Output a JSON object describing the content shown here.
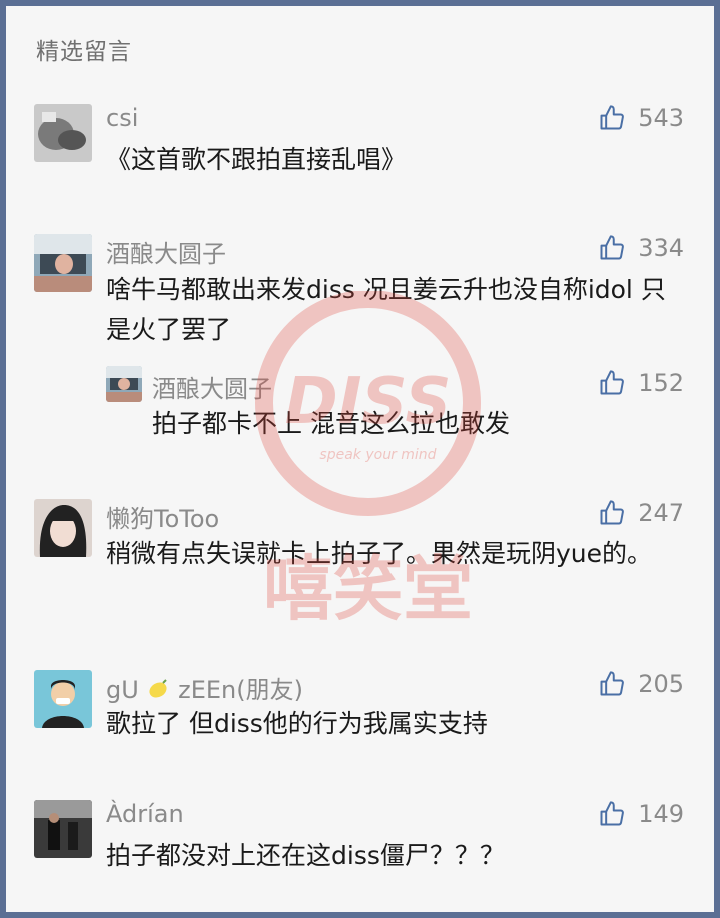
{
  "section_title": "精选留言",
  "comments": [
    {
      "name": "csi",
      "text": "《这首歌不跟拍直接乱唱》",
      "likes": "543"
    },
    {
      "name": "酒酿大圆子",
      "text": "啥牛马都敢出来发diss 况且姜云升也没自称idol 只是火了罢了",
      "likes": "334"
    },
    {
      "name": "酒酿大圆子",
      "text": "拍子都卡不上 混音这么拉也敢发",
      "likes": "152"
    },
    {
      "name": "懒狗ToToo",
      "text": "稍微有点失误就卡上拍子了。果然是玩阴yue的。",
      "likes": "247"
    },
    {
      "name_a": "gU",
      "name_b": "zEEn(朋友)",
      "text": "歌拉了 但diss他的行为我属实支持",
      "likes": "205"
    },
    {
      "name": "Àdrían",
      "text": "拍子都没对上还在这diss僵尸？？？",
      "likes": "149"
    }
  ],
  "watermark": {
    "top": "DISS",
    "small": "speak your mind",
    "bottom": "嘻笑堂",
    "color": "#e0453a"
  },
  "icons": {
    "like": "thumbs-up-icon",
    "lemon": "lemon-emoji-icon"
  }
}
